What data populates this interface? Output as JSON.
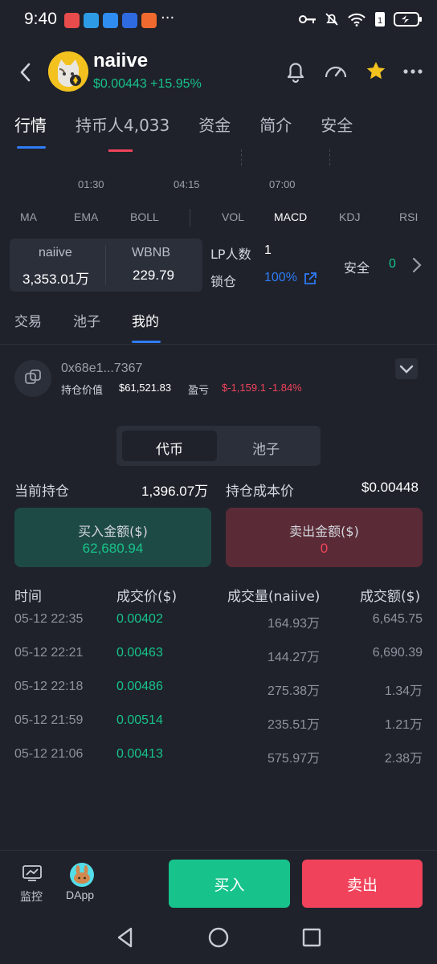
{
  "status_bar": {
    "time": "9:40",
    "notification_icons": [
      "red-app-icon",
      "telegram-icon",
      "blue-app-icon",
      "lightbulb-app-icon",
      "orange-app-icon"
    ],
    "more": "···"
  },
  "header": {
    "token_name": "naiive",
    "price_change": "$0.00443 +15.95%"
  },
  "tabs": [
    "行情",
    "持币人4,033",
    "资金",
    "简介",
    "安全"
  ],
  "chart": {
    "time_labels": [
      "01:30",
      "04:15",
      "07:00"
    ],
    "indicators_left": [
      "MA",
      "EMA",
      "BOLL"
    ],
    "indicators_right": [
      "VOL",
      "MACD",
      "KDJ",
      "RSI"
    ],
    "active_indicator": "MACD"
  },
  "pair": {
    "base_name": "naiive",
    "base_amount": "3,353.01万",
    "quote_name": "WBNB",
    "quote_amount": "229.79",
    "lp_label": "LP人数",
    "lp_count": "1",
    "lock_label": "锁仓",
    "lock_value": "100%",
    "safety_label": "安全",
    "safety_value": "0"
  },
  "sub_tabs": [
    "交易",
    "池子",
    "我的"
  ],
  "wallet": {
    "address": "0x68e1...7367",
    "holding_label": "持仓价值",
    "holding_value": "$61,521.83",
    "pnl_label": "盈亏",
    "pnl_value": "$-1,159.1 -1.84%"
  },
  "segment": [
    "代币",
    "池子"
  ],
  "position": {
    "current_label": "当前持仓",
    "current_value": "1,396.07万",
    "cost_label": "持仓成本价",
    "cost_value": "$0.00448"
  },
  "buy_box": {
    "label": "买入金额($)",
    "value": "62,680.94"
  },
  "sell_box": {
    "label": "卖出金额($)",
    "value": "0"
  },
  "table": {
    "headers": [
      "时间",
      "成交价($)",
      "成交量(naiive)",
      "成交额($)"
    ],
    "rows": [
      [
        "05-12 22:35",
        "0.00402",
        "164.93万",
        "6,645.75"
      ],
      [
        "05-12 22:21",
        "0.00463",
        "144.27万",
        "6,690.39"
      ],
      [
        "05-12 22:18",
        "0.00486",
        "275.38万",
        "1.34万"
      ],
      [
        "05-12 21:59",
        "0.00514",
        "235.51万",
        "1.21万"
      ],
      [
        "05-12 21:06",
        "0.00413",
        "575.97万",
        "2.38万"
      ]
    ]
  },
  "bottom_nav": {
    "monitor": "监控",
    "dapp": "DApp",
    "buy": "买入",
    "sell": "卖出"
  },
  "colors": {
    "background": "#1f222b",
    "green": "#17c38a",
    "red": "#f0435b",
    "accent_blue": "#2e7cf6",
    "star": "#f4c21e"
  }
}
